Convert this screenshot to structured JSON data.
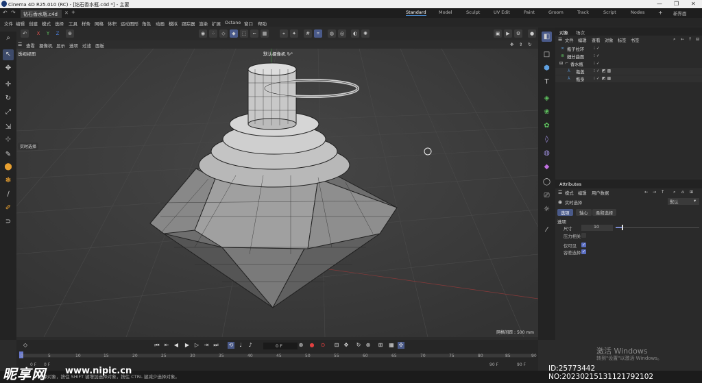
{
  "titlebar": {
    "app_title": "Cinema 4D R25.010 (RC) - [钻石香水瓶.c4d *] - 主要",
    "minimize": "—",
    "maximize": "❐",
    "close": "✕"
  },
  "doc_tab": {
    "label": "钻石香水瓶.c4d *",
    "close": "✕",
    "add": "+"
  },
  "layouts": [
    "Standard",
    "Model",
    "Sculpt",
    "UV Edit",
    "Paint",
    "Groom",
    "Track",
    "Script",
    "Nodes"
  ],
  "layout_active": "Standard",
  "layout_extra": {
    "plus": "+",
    "new_ui": "新界面"
  },
  "menus": [
    "文件",
    "编辑",
    "创建",
    "模式",
    "选择",
    "工具",
    "样条",
    "网格",
    "体积",
    "运动图形",
    "角色",
    "动画",
    "模拟",
    "跟踪器",
    "渲染",
    "扩展",
    "Octane",
    "窗口",
    "帮助"
  ],
  "axis_locks": {
    "x": "X",
    "y": "Y",
    "z": "Z"
  },
  "viewport_menus": [
    "查看",
    "摄像机",
    "显示",
    "选项",
    "过滤",
    "面板"
  ],
  "viewport": {
    "view_name": "透视视图",
    "camera": "默认摄像机 ↻°",
    "realtime_select": "实时选择",
    "grid_spacing": "网格间距 : 500 mm"
  },
  "object_panel": {
    "tabs": [
      "对象",
      "场次"
    ],
    "menus": [
      "文件",
      "编辑",
      "查看",
      "对象",
      "标签",
      "书签"
    ],
    "objects": [
      {
        "name": "瓶子拉环",
        "indent": 0
      },
      {
        "name": "细分曲面",
        "indent": 0
      },
      {
        "name": "香水瓶",
        "indent": 1
      },
      {
        "name": "瓶盖",
        "indent": 2
      },
      {
        "name": "瓶身",
        "indent": 2
      }
    ]
  },
  "attributes": {
    "header": "Attributes",
    "menus": [
      "模式",
      "编辑",
      "用户数据"
    ],
    "tool_name": "实时选择",
    "preset": "默认",
    "tabs": [
      "选项",
      "轴心",
      "柔和选择"
    ],
    "section": "选项",
    "radius_label": "尺寸",
    "radius_value": "10",
    "pressure_label": "压力相关",
    "visible_only_label": "仅可见",
    "tolerant_label": "容差选择",
    "pressure_checked": false,
    "visible_only_checked": true,
    "tolerant_checked": true
  },
  "timeline": {
    "current_frame": "0 F",
    "ticks": [
      "0",
      "5",
      "10",
      "15",
      "20",
      "25",
      "30",
      "35",
      "40",
      "45",
      "50",
      "55",
      "60",
      "65",
      "70",
      "75",
      "80",
      "85",
      "90"
    ],
    "end_frame_a": "90 F",
    "end_frame_b": "90 F",
    "start_a": "0 F",
    "start_b": "0 F"
  },
  "status_text": "选择对象，按住 SHIFT 键增加选择对象，按住 CTRL 键减少选择对象。",
  "windows_activation": {
    "line1": "激活 Windows",
    "line2": "转到\"设置\"以激活 Windows。"
  },
  "watermark": {
    "site": "昵享网",
    "url": "www.nipic.cn",
    "id": "ID:25773442 NO:20230215131121792102"
  },
  "colors": {
    "accent": "#4a5a8a",
    "checkbox_on": "#5b6fc4",
    "x_axis": "#e0504a",
    "y_axis": "#5fc35f",
    "z_axis": "#4a7fe0"
  }
}
